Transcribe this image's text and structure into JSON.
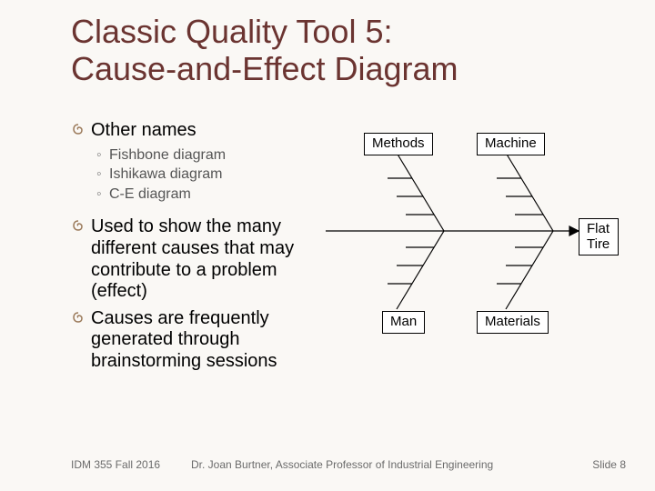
{
  "title_line1": "Classic Quality Tool 5:",
  "title_line2": "Cause-and-Effect Diagram",
  "bullets": {
    "b1": "Other names",
    "b1_subs": [
      "Fishbone diagram",
      "Ishikawa diagram",
      "C-E diagram"
    ],
    "b2": "Used to show the many different causes that may contribute to a problem (effect)",
    "b3": "Causes are frequently generated through brainstorming sessions"
  },
  "diagram": {
    "methods": "Methods",
    "machine": "Machine",
    "man": "Man",
    "materials": "Materials",
    "effect_line1": "Flat",
    "effect_line2": "Tire"
  },
  "footer": {
    "course": "IDM 355 Fall 2016",
    "author": "Dr. Joan Burtner, Associate Professor of Industrial Engineering",
    "slide": "Slide 8"
  },
  "chart_data": {
    "type": "table",
    "title": "Cause-and-Effect (Fishbone) Diagram",
    "effect": "Flat Tire",
    "categories": [
      "Methods",
      "Machine",
      "Man",
      "Materials"
    ]
  }
}
